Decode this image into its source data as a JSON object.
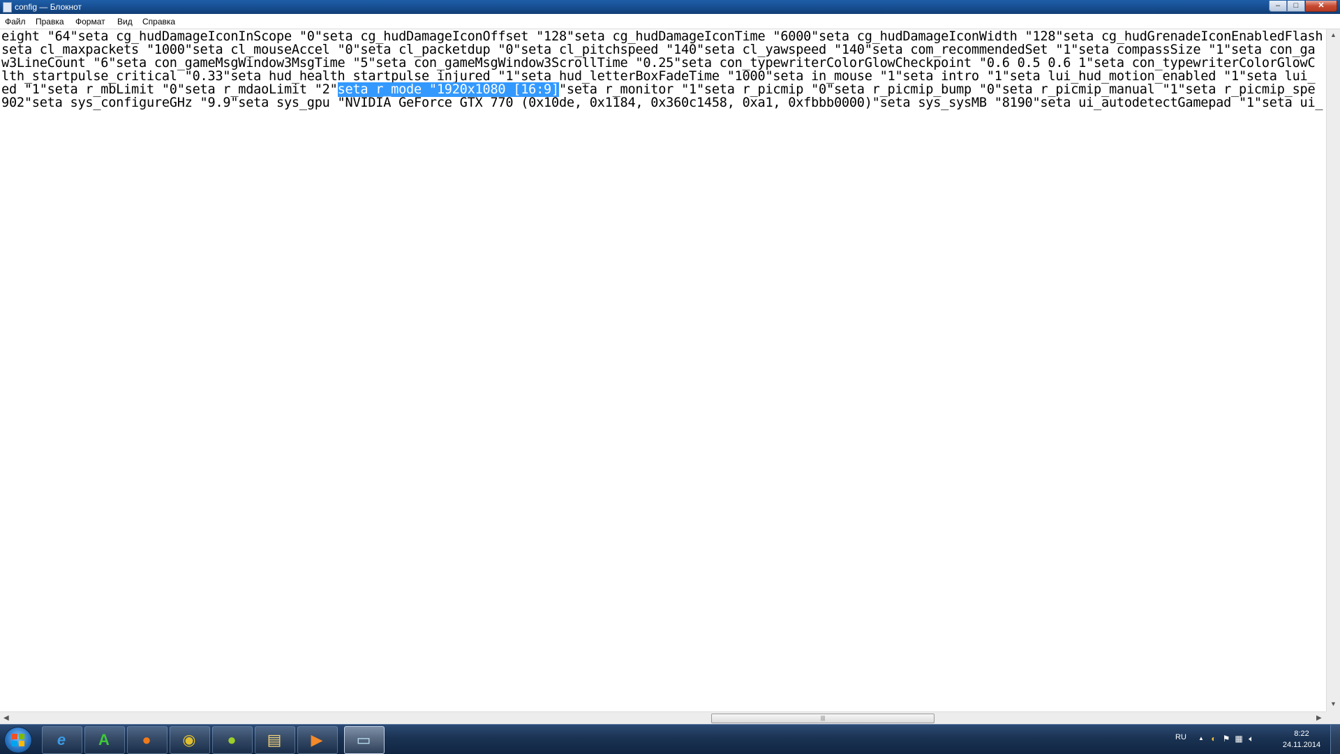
{
  "window": {
    "title": "config — Блокнот",
    "buttons": {
      "minimize": "–",
      "maximize": "□",
      "close": "✕"
    }
  },
  "menu": [
    {
      "label": "Файл"
    },
    {
      "label": "Правка"
    },
    {
      "label": "Формат"
    },
    {
      "label": "Вид"
    },
    {
      "label": "Справка"
    }
  ],
  "editor": {
    "lines": [
      {
        "before": "eight \"64\"seta cg_hudDamageIconInScope \"0\"seta cg_hudDamageIconOffset \"128\"seta cg_hudDamageIconTime \"6000\"seta cg_hudDamageIconWidth \"128\"seta cg_hudGrenadeIconEnabledFlash",
        "selected": "",
        "after": ""
      },
      {
        "before": "seta cl_maxpackets \"1000\"seta cl_mouseAccel \"0\"seta cl_packetdup \"0\"seta cl_pitchspeed \"140\"seta cl_yawspeed \"140\"seta com_recommendedSet \"1\"seta compassSize \"1\"seta con_ga",
        "selected": "",
        "after": ""
      },
      {
        "before": "w3LineCount \"6\"seta con_gameMsgWindow3MsgTime \"5\"seta con_gameMsgWindow3ScrollTime \"0.25\"seta con_typewriterColorGlowCheckpoint \"0.6 0.5 0.6 1\"seta con_typewriterColorGlowC",
        "selected": "",
        "after": ""
      },
      {
        "before": "lth_startpulse_critical \"0.33\"seta hud_health_startpulse_injured \"1\"seta hud_letterBoxFadeTime \"1000\"seta in_mouse \"1\"seta intro \"1\"seta lui_hud_motion_enabled \"1\"seta lui_",
        "selected": "",
        "after": ""
      },
      {
        "before": "ed \"1\"seta r_mbLimit \"0\"seta r_mdaoLimit \"2\"",
        "selected": "seta r_mode \"1920x1080 [16:9]",
        "after": "\"seta r_monitor \"1\"seta r_picmip \"0\"seta r_picmip_bump \"0\"seta r_picmip_manual \"1\"seta r_picmip_spe"
      },
      {
        "before": "902\"seta sys_configureGHz \"9.9\"seta sys_gpu \"NVIDIA GeForce GTX 770 (0x10de, 0x1184, 0x360c1458, 0xa1, 0xfbbb0000)\"seta sys_sysMB \"8190\"seta ui_autodetectGamepad \"1\"seta ui_",
        "selected": "",
        "after": ""
      }
    ]
  },
  "scrollbars": {
    "left_arrow": "◀",
    "right_arrow": "▶",
    "up_arrow": "▲",
    "down_arrow": "▼",
    "thumb_grip": "|||"
  },
  "taskbar": {
    "apps": [
      {
        "name": "internet-explorer",
        "glyph": "e",
        "color": "#3b9be6"
      },
      {
        "name": "a-app",
        "glyph": "A",
        "color": "#3fc83a"
      },
      {
        "name": "firefox",
        "glyph": "●",
        "color": "#f07a1a"
      },
      {
        "name": "chrome",
        "glyph": "◉",
        "color": "#e0c030"
      },
      {
        "name": "media-app",
        "glyph": "●",
        "color": "#9ccf2a"
      },
      {
        "name": "file-explorer",
        "glyph": "▤",
        "color": "#f2d27a"
      },
      {
        "name": "media-player",
        "glyph": "▶",
        "color": "#f48a2a"
      },
      {
        "name": "notepad",
        "glyph": "▭",
        "color": "#bfe3f5"
      }
    ],
    "tray": {
      "language": "RU",
      "show_hidden": "▲"
    },
    "clock": {
      "time": "8:22",
      "date": "24.11.2014"
    }
  }
}
